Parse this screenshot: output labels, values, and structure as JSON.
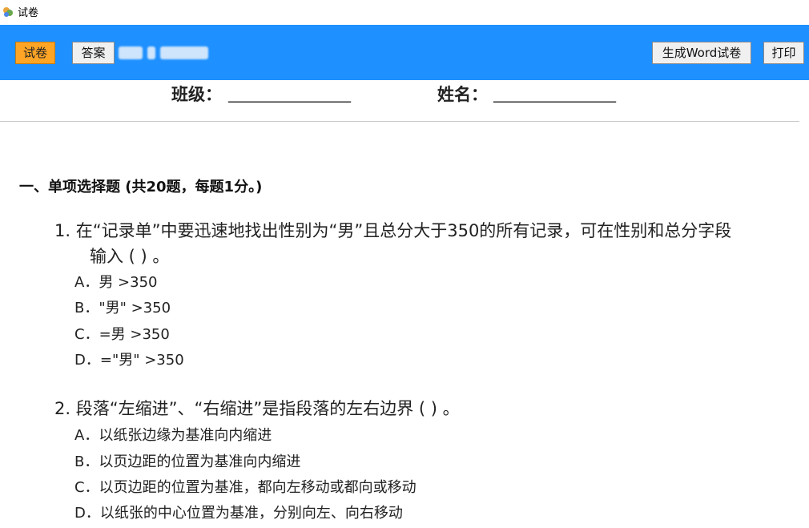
{
  "window": {
    "title": "试卷",
    "icon": "app-icon"
  },
  "toolbar": {
    "tab_exam": "试卷",
    "tab_answer": "答案",
    "generate_word": "生成Word试卷",
    "print": "打印",
    "colors": {
      "bar": "#1e90ff",
      "active_tab": "#ffa526"
    }
  },
  "header": {
    "class_label": "班级：",
    "class_blank": "________________",
    "name_label": "姓名：",
    "name_blank": "________________"
  },
  "section": {
    "title": "一、单项选择题 (共20题，每题1分。)"
  },
  "questions": [
    {
      "stem_line1": "1. 在“记录单”中要迅速地找出性别为“男”且总分大于350的所有记录，可在性别和总分字段",
      "stem_line2": "输入 ( ) 。",
      "options": [
        "A．男 >350",
        "B．\"男\" >350",
        "C．=男 >350",
        "D．=\"男\" >350"
      ]
    },
    {
      "stem_line1": "2. 段落“左缩进”、“右缩进”是指段落的左右边界 ( ) 。",
      "options": [
        "A．以纸张边缘为基准向内缩进",
        "B．以页边距的位置为基准向内缩进",
        "C．以页边距的位置为基准，都向左移动或都向或移动",
        "D．以纸张的中心位置为基准，分别向左、向右移动"
      ]
    }
  ]
}
